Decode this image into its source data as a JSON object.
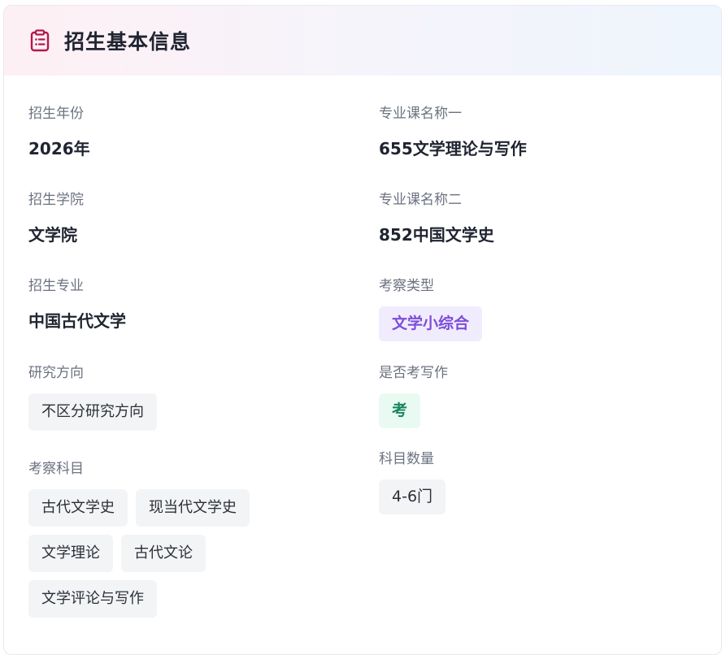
{
  "header": {
    "title": "招生基本信息",
    "icon": "clipboard-icon",
    "accent": "#b5174b"
  },
  "left": {
    "year": {
      "label": "招生年份",
      "value": "2026年"
    },
    "college": {
      "label": "招生学院",
      "value": "文学院"
    },
    "major": {
      "label": "招生专业",
      "value": "中国古代文学"
    },
    "direction": {
      "label": "研究方向",
      "tags": [
        "不区分研究方向"
      ]
    },
    "subjects": {
      "label": "考察科目",
      "tags": [
        "古代文学史",
        "现当代文学史",
        "文学理论",
        "古代文论",
        "文学评论与写作"
      ]
    }
  },
  "right": {
    "course1": {
      "label": "专业课名称一",
      "value": "655文学理论与写作"
    },
    "course2": {
      "label": "专业课名称二",
      "value": "852中国文学史"
    },
    "exam_type": {
      "label": "考察类型",
      "value": "文学小综合",
      "color": "#7c4ddb"
    },
    "writing": {
      "label": "是否考写作",
      "value": "考",
      "color": "#16865c"
    },
    "subject_count": {
      "label": "科目数量",
      "value": "4-6门"
    }
  }
}
